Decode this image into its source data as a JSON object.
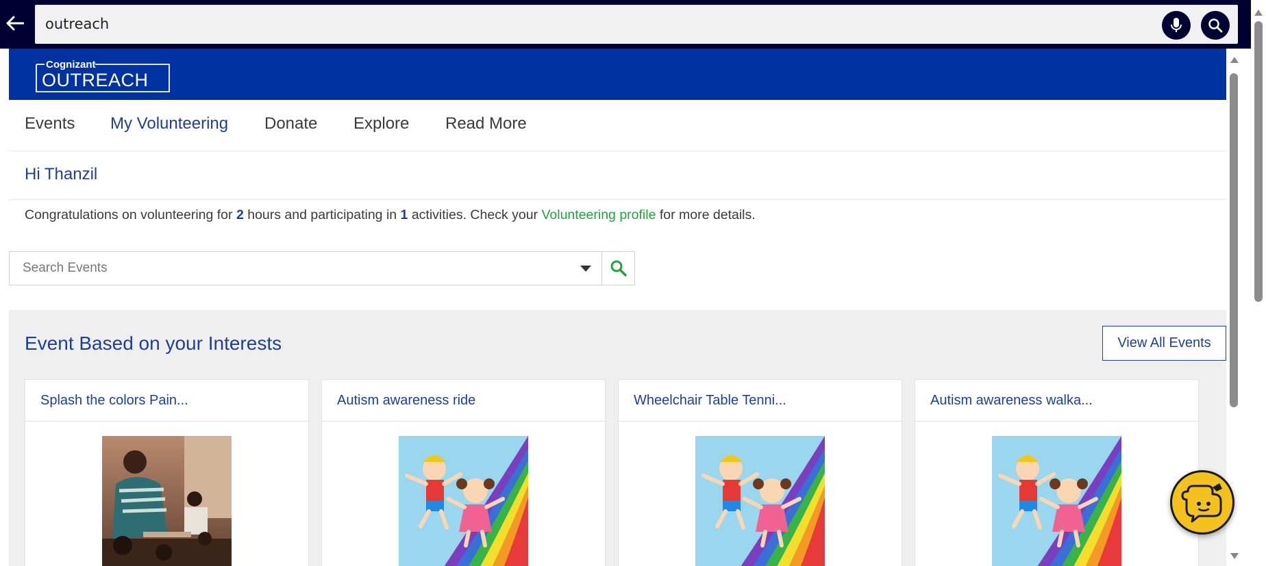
{
  "browser": {
    "search_query": "outreach"
  },
  "brand": {
    "company": "Cognizant",
    "product": "OUTREACH",
    "bar_color": "#0033a1"
  },
  "nav": {
    "items": [
      {
        "label": "Events"
      },
      {
        "label": "My Volunteering"
      },
      {
        "label": "Donate"
      },
      {
        "label": "Explore"
      },
      {
        "label": "Read More"
      }
    ],
    "active": "My Volunteering"
  },
  "greeting": "Hi Thanzil",
  "congrats": {
    "prefix": "Congratulations on volunteering for ",
    "hours": "2",
    "middle": " hours and participating in ",
    "activities": "1",
    "suffix": " activities. Check your ",
    "link": "Volunteering profile",
    "end": " for more details."
  },
  "event_search": {
    "placeholder": "Search Events"
  },
  "interests": {
    "title": "Event Based on your Interests",
    "view_all_label": "View All Events",
    "cards": [
      {
        "title": "Splash the colors Pain...",
        "image": "classroom-photo"
      },
      {
        "title": "Autism awareness ride",
        "image": "kids-rainbow-illustration"
      },
      {
        "title": "Wheelchair Table Tenni...",
        "image": "kids-rainbow-illustration"
      },
      {
        "title": "Autism awareness walka...",
        "image": "kids-rainbow-illustration"
      }
    ]
  },
  "colors": {
    "accent_blue": "#1d3f9a",
    "link_green": "#22a33a",
    "chatbot_yellow": "#f4c21f"
  },
  "icons": [
    "back-arrow-icon",
    "microphone-icon",
    "search-icon",
    "dropdown-caret-icon",
    "magnifier-icon",
    "chatbot-icon"
  ]
}
